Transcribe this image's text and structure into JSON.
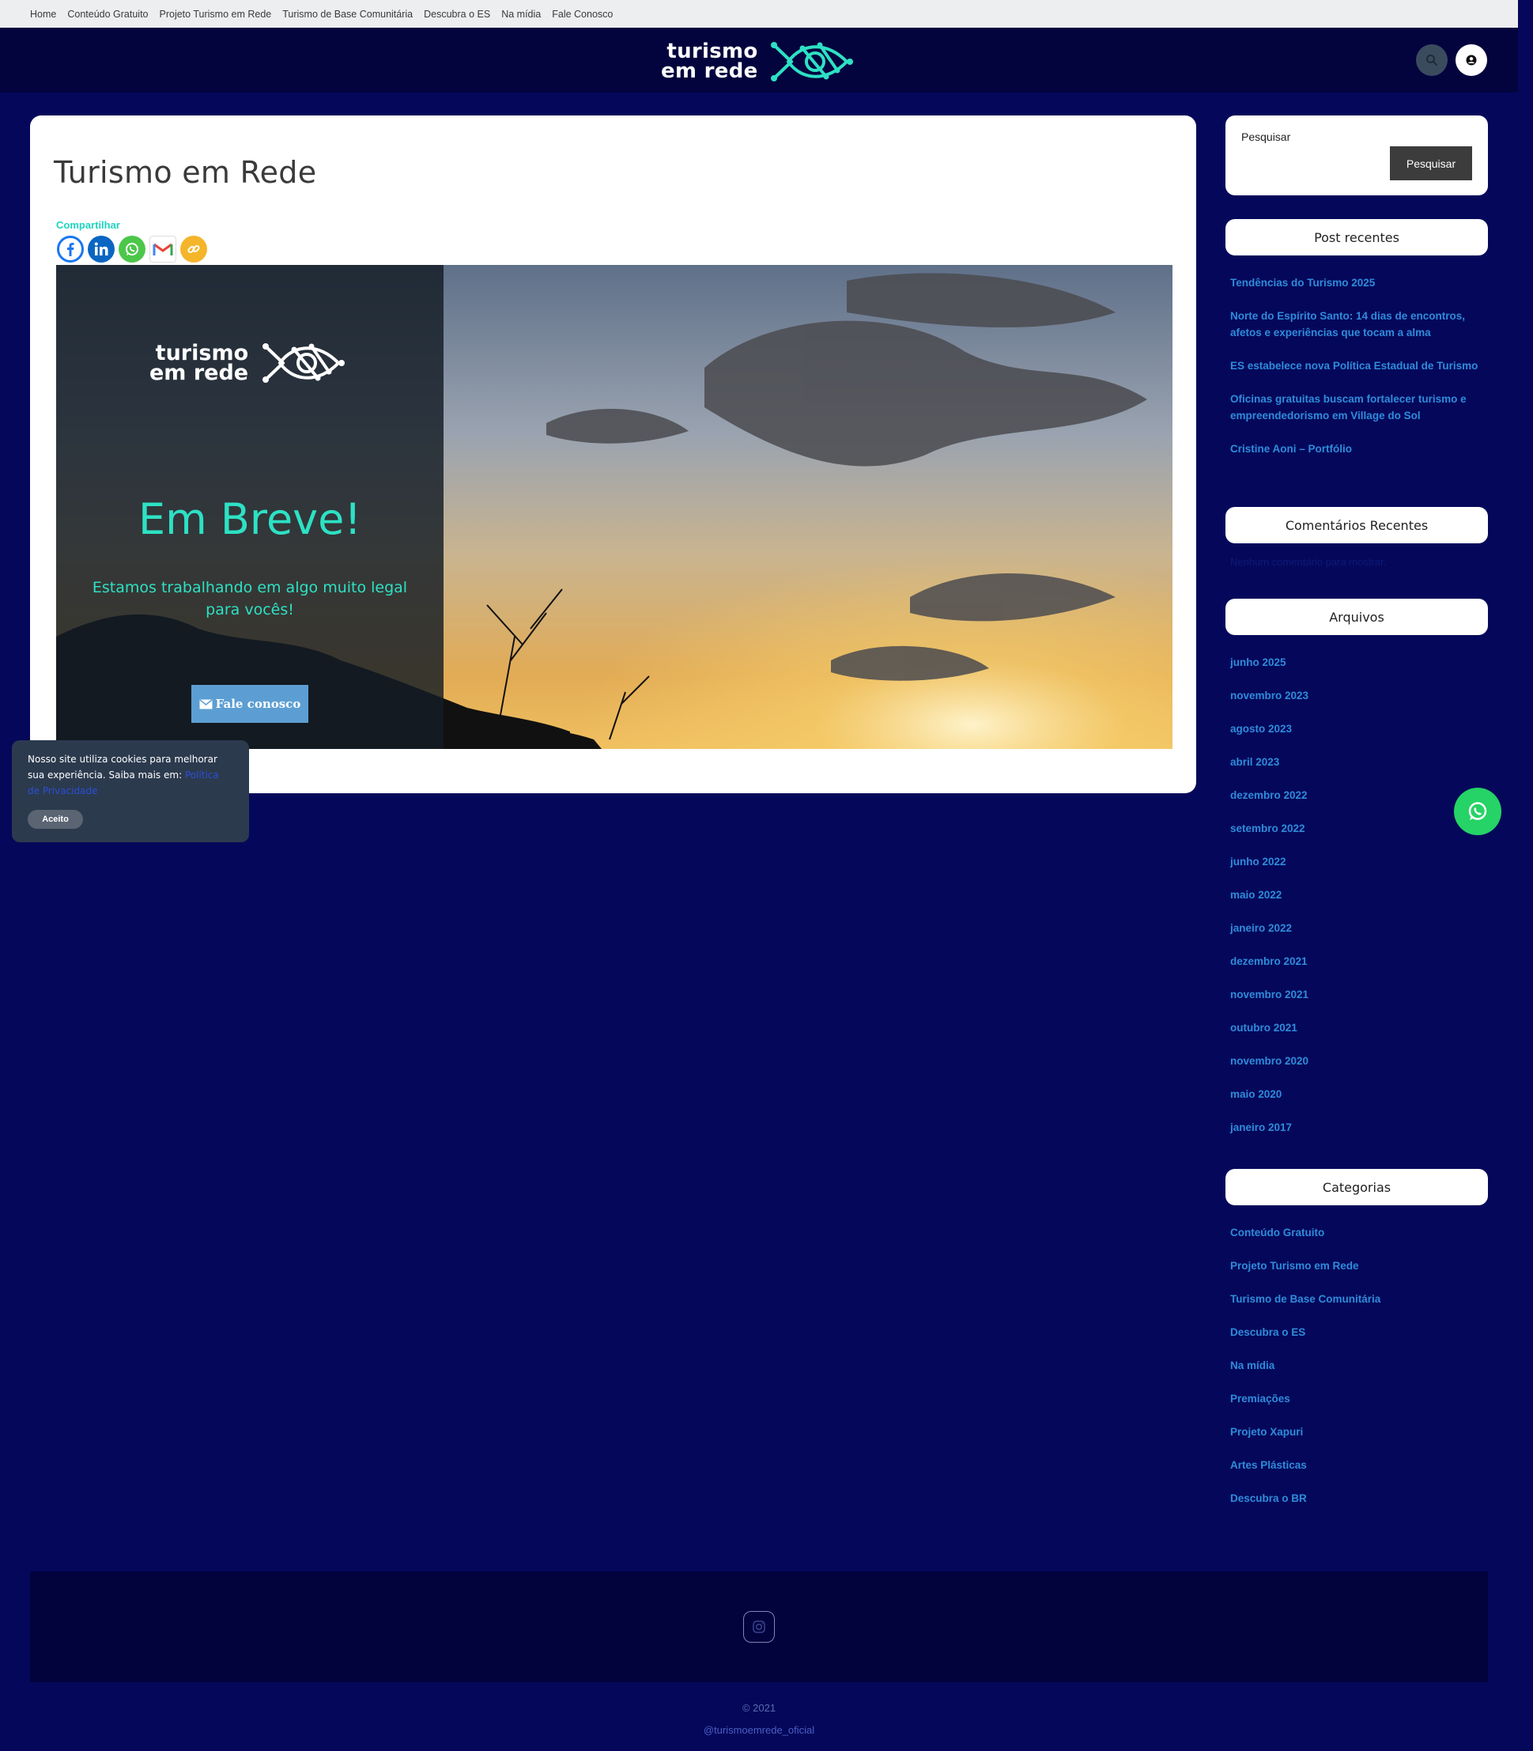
{
  "topnav": {
    "items": [
      "Home",
      "Conteúdo Gratuito",
      "Projeto Turismo em Rede",
      "Turismo de Base Comunitária",
      "Descubra o ES",
      "Na mídia",
      "Fale Conosco"
    ]
  },
  "header": {
    "logo_line1": "turismo",
    "logo_line2": "em rede",
    "search_icon": "search-icon",
    "user_icon": "user-icon"
  },
  "page": {
    "title": "Turismo em Rede",
    "share_label": "Compartilhar",
    "share_icons": [
      "facebook-icon",
      "linkedin-icon",
      "whatsapp-icon",
      "gmail-icon",
      "copy-link-icon"
    ]
  },
  "hero": {
    "logo_line1": "turismo",
    "logo_line2": "em rede",
    "title": "Em Breve!",
    "subtitle": "Estamos trabalhando em algo muito legal para vocês!",
    "button_label": "Fale conosco"
  },
  "sidebar": {
    "search_label": "Pesquisar",
    "search_button": "Pesquisar",
    "recent_posts_title": "Post recentes",
    "recent_posts": [
      "Tendências do Turismo 2025",
      "Norte do Espírito Santo: 14 dias de encontros, afetos e experiências que tocam a alma",
      "ES estabelece nova Política Estadual de Turismo",
      "Oficinas gratuitas buscam fortalecer turismo e empreendedorismo em Village do Sol",
      "Cristine Aoni – Portfólio"
    ],
    "recent_comments_title": "Comentários Recentes",
    "recent_comments_text": "Nenhum comentário para mostrar.",
    "archives_title": "Arquivos",
    "archives": [
      "junho 2025",
      "novembro 2023",
      "agosto 2023",
      "abril 2023",
      "dezembro 2022",
      "setembro 2022",
      "junho 2022",
      "maio 2022",
      "janeiro 2022",
      "dezembro 2021",
      "novembro 2021",
      "outubro 2021",
      "novembro 2020",
      "maio 2020",
      "janeiro 2017"
    ],
    "categories_title": "Categorias",
    "categories": [
      "Conteúdo Gratuito",
      "Projeto Turismo em Rede",
      "Turismo de Base Comunitária",
      "Descubra o ES",
      "Na mídia",
      "Premiações",
      "Projeto Xapuri",
      "Artes Plásticas",
      "Descubra o BR"
    ]
  },
  "cookie": {
    "text": "Nosso site utiliza cookies para melhorar sua experiência. Saiba mais em:",
    "link": "Política de Privacidade",
    "accept": "Aceito"
  },
  "footer": {
    "icon": "instagram-icon",
    "copyright": "© 2021",
    "handle": "@turismoemrede_oficial"
  },
  "colors": {
    "background": "#05085a",
    "header": "#03043e",
    "accent_teal": "#2de1c4",
    "link_blue": "#2f8bdb",
    "whatsapp": "#25d366"
  }
}
